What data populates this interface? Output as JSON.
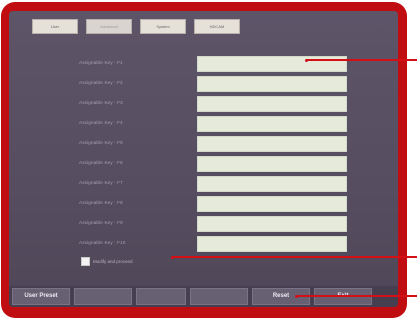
{
  "tabs": [
    {
      "label": "User",
      "active": false
    },
    {
      "label": "Advanced",
      "active": true
    },
    {
      "label": "System",
      "active": false
    },
    {
      "label": "HDCAM",
      "active": false
    }
  ],
  "assignable_keys": {
    "rows": [
      {
        "label": "Assignable Key : F1",
        "value": ""
      },
      {
        "label": "Assignable Key : F2",
        "value": ""
      },
      {
        "label": "Assignable Key : F3",
        "value": ""
      },
      {
        "label": "Assignable Key : F4",
        "value": ""
      },
      {
        "label": "Assignable Key : F5",
        "value": ""
      },
      {
        "label": "Assignable Key : F6",
        "value": ""
      },
      {
        "label": "Assignable Key : F7",
        "value": ""
      },
      {
        "label": "Assignable Key : F8",
        "value": ""
      },
      {
        "label": "Assignable Key : F9",
        "value": ""
      },
      {
        "label": "Assignable Key : F10",
        "value": ""
      }
    ]
  },
  "option": {
    "label": "Modify and proceed",
    "checked": false
  },
  "footer": {
    "buttons": [
      "User Preset",
      "",
      "",
      "",
      "Reset",
      "Exit"
    ]
  },
  "colors": {
    "bezel": "#c00d12",
    "screen": "#564d60",
    "callout": "#d40f16"
  }
}
